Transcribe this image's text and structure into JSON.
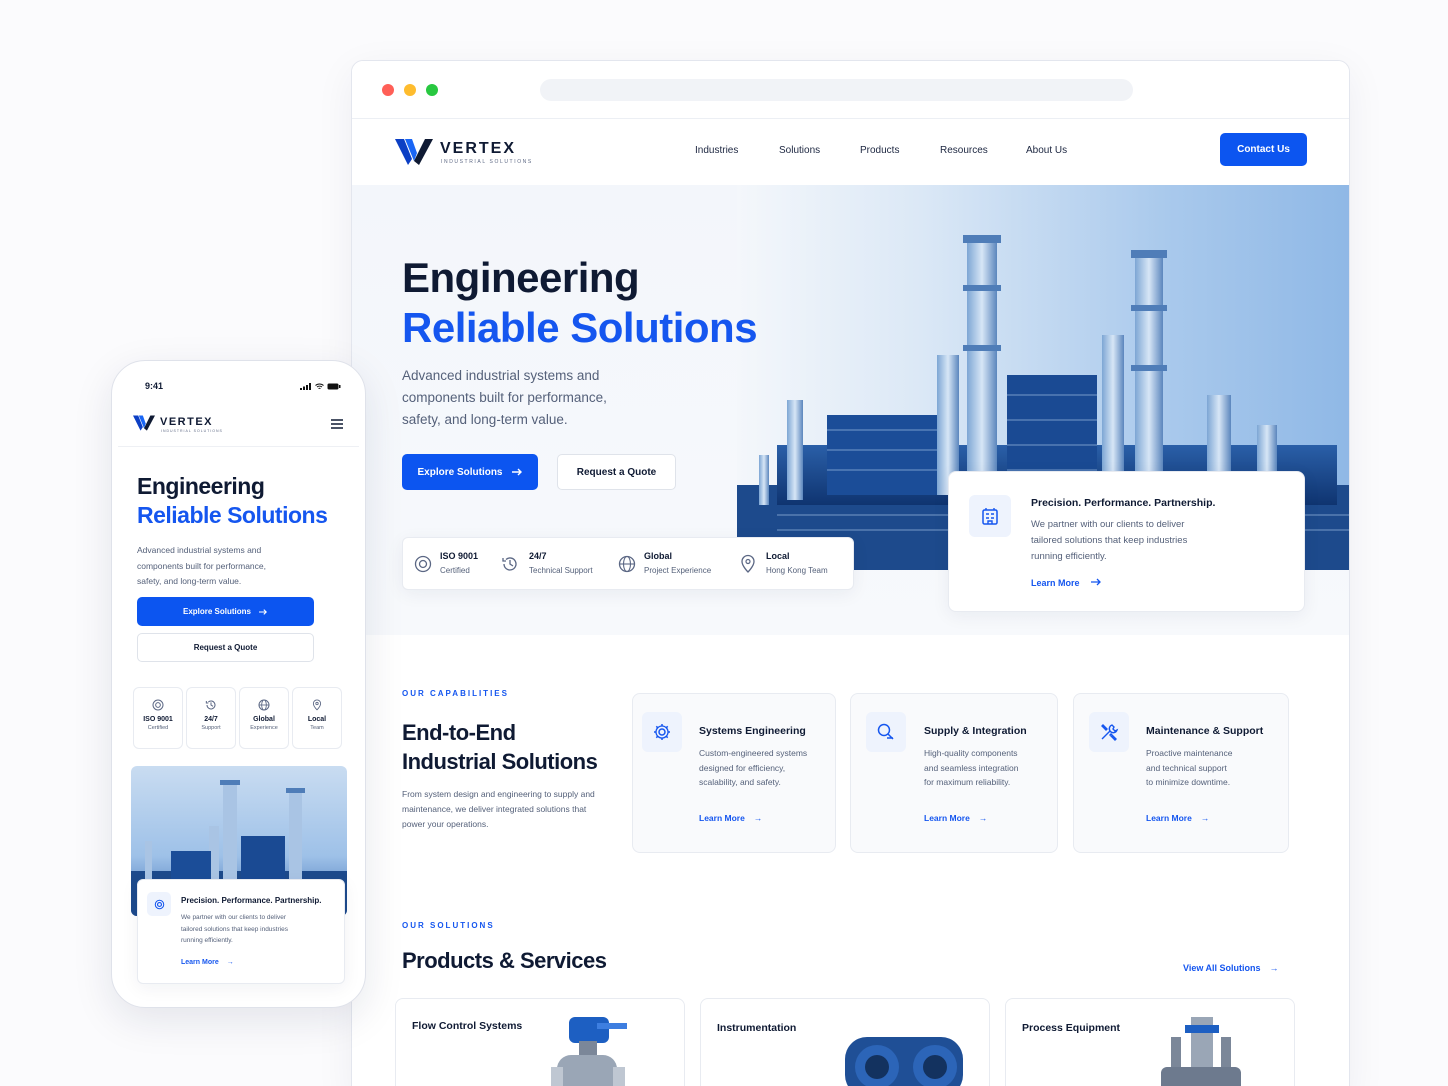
{
  "brand": {
    "name": "VERTEX",
    "tagline": "INDUSTRIAL SOLUTIONS"
  },
  "nav": {
    "items": [
      "Industries",
      "Solutions",
      "Products",
      "Resources",
      "About Us"
    ],
    "contact": "Contact Us"
  },
  "hero": {
    "title_line1": "Engineering",
    "title_line2": "Reliable Solutions",
    "subtitle_line1": "Advanced industrial systems and",
    "subtitle_line2": "components built for performance,",
    "subtitle_line3": "safety, and long-term value.",
    "cta_primary": "Explore Solutions",
    "cta_secondary": "Request a Quote",
    "stats": [
      {
        "title": "ISO 9001",
        "sub": "Certified",
        "icon": "shield-icon"
      },
      {
        "title": "24/7",
        "sub": "Technical Support",
        "icon": "clock-icon"
      },
      {
        "title": "Global",
        "sub": "Project Experience",
        "icon": "globe-icon"
      },
      {
        "title": "Local",
        "sub": "Hong Kong Team",
        "icon": "location-pin-icon"
      }
    ],
    "feature_card": {
      "title": "Precision. Performance. Partnership.",
      "line1": "We partner with our clients to deliver",
      "line2": "tailored solutions that keep industries",
      "line3": "running efficiently.",
      "link": "Learn More"
    }
  },
  "capabilities": {
    "eyebrow": "OUR CAPABILITIES",
    "title_line1": "End-to-End",
    "title_line2": "Industrial Solutions",
    "desc_line1": "From system design and engineering to supply and",
    "desc_line2": "maintenance, we deliver integrated solutions that",
    "desc_line3": "power your operations.",
    "cards": [
      {
        "title": "Systems Engineering",
        "l1": "Custom-engineered systems",
        "l2": "designed for efficiency,",
        "l3": "scalability, and safety.",
        "link": "Learn More",
        "icon": "gear-icon"
      },
      {
        "title": "Supply & Integration",
        "l1": "High-quality components",
        "l2": "and seamless integration",
        "l3": "for maximum reliability.",
        "link": "Learn More",
        "icon": "integration-icon"
      },
      {
        "title": "Maintenance & Support",
        "l1": "Proactive maintenance",
        "l2": "and technical support",
        "l3": "to minimize downtime.",
        "link": "Learn More",
        "icon": "tools-icon"
      }
    ]
  },
  "solutions": {
    "eyebrow": "OUR SOLUTIONS",
    "title": "Products & Services",
    "view_all": "View All Solutions",
    "products": [
      "Flow Control Systems",
      "Instrumentation",
      "Process Equipment"
    ]
  },
  "mobile": {
    "time": "9:41",
    "title_line1": "Engineering",
    "title_line2": "Reliable Solutions",
    "sub_line1": "Advanced industrial systems and",
    "sub_line2": "components built for performance,",
    "sub_line3": "safety, and long-term value.",
    "cta_primary": "Explore Solutions",
    "cta_secondary": "Request a Quote",
    "stats": [
      {
        "title": "ISO 9001",
        "sub": "Certified"
      },
      {
        "title": "24/7",
        "sub": "Support"
      },
      {
        "title": "Global",
        "sub": "Experience"
      },
      {
        "title": "Local",
        "sub": "Team"
      }
    ],
    "card_title": "Precision. Performance. Partnership.",
    "card_l1": "We partner with our clients to deliver",
    "card_l2": "tailored solutions that keep industries",
    "card_l3": "running efficiently.",
    "card_link": "Learn More"
  },
  "colors": {
    "accent": "#1556ef",
    "dark": "#0f1a33"
  }
}
